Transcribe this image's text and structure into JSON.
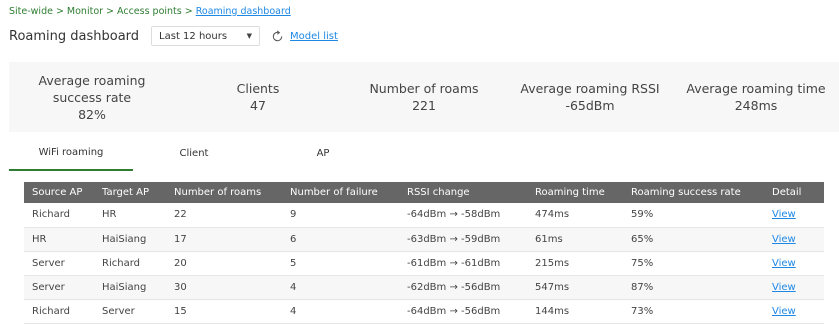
{
  "breadcrumb": {
    "items": [
      "Site-wide",
      "Monitor",
      "Access points"
    ],
    "current": "Roaming dashboard",
    "separator": ">"
  },
  "header": {
    "title": "Roaming dashboard",
    "range_value": "Last 12 hours",
    "refresh_icon": "refresh-icon",
    "model_list_link": "Model list"
  },
  "summary": [
    {
      "label_line1": "Average roaming",
      "label_line2": "success rate",
      "value": "82%"
    },
    {
      "label_line1": "Clients",
      "label_line2": "",
      "value": "47"
    },
    {
      "label_line1": "Number of roams",
      "label_line2": "",
      "value": "221"
    },
    {
      "label_line1": "Average roaming RSSI",
      "label_line2": "",
      "value": "-65dBm"
    },
    {
      "label_line1": "Average roaming time",
      "label_line2": "",
      "value": "248ms"
    }
  ],
  "tabs": [
    {
      "label": "WiFi roaming",
      "active": true
    },
    {
      "label": "Client",
      "active": false
    },
    {
      "label": "AP",
      "active": false
    }
  ],
  "table": {
    "columns": [
      "Source AP",
      "Target AP",
      "Number of roams",
      "Number of failure",
      "RSSI change",
      "Roaming time",
      "Roaming success rate",
      "Detail"
    ],
    "rows": [
      [
        "Richard",
        "HR",
        "22",
        "9",
        "-64dBm → -58dBm",
        "474ms",
        "59%",
        "View"
      ],
      [
        "HR",
        "HaiSiang",
        "17",
        "6",
        "-63dBm → -59dBm",
        "61ms",
        "65%",
        "View"
      ],
      [
        "Server",
        "Richard",
        "20",
        "5",
        "-61dBm → -61dBm",
        "215ms",
        "75%",
        "View"
      ],
      [
        "Server",
        "HaiSiang",
        "30",
        "4",
        "-62dBm → -56dBm",
        "547ms",
        "87%",
        "View"
      ],
      [
        "Richard",
        "Server",
        "15",
        "4",
        "-64dBm → -56dBm",
        "144ms",
        "73%",
        "View"
      ]
    ]
  },
  "colors": {
    "breadcrumb": "#2e7d32",
    "link": "#1e88e5",
    "table_header_bg": "#666666",
    "active_tab_underline": "#2e7d32",
    "summary_bg": "#f7f7f7"
  }
}
